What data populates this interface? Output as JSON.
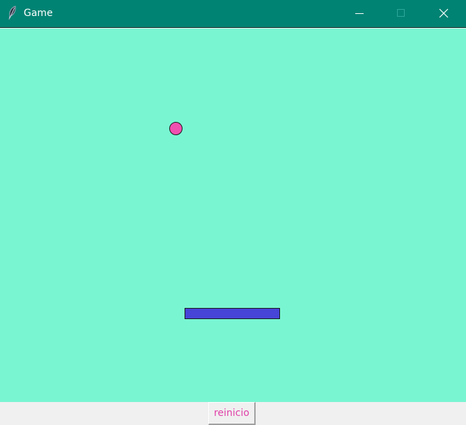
{
  "window": {
    "title": "Game",
    "icon": "feather-icon"
  },
  "controls": {
    "minimize_icon": "minimize-icon",
    "maximize_icon": "maximize-icon",
    "close_icon": "close-icon"
  },
  "game": {
    "background_color": "#79f5d2",
    "ball_color": "#f050b0",
    "paddle_color": "#4645d7"
  },
  "toolbar": {
    "reset_label": "reinicio",
    "reset_color": "#e040a8"
  }
}
